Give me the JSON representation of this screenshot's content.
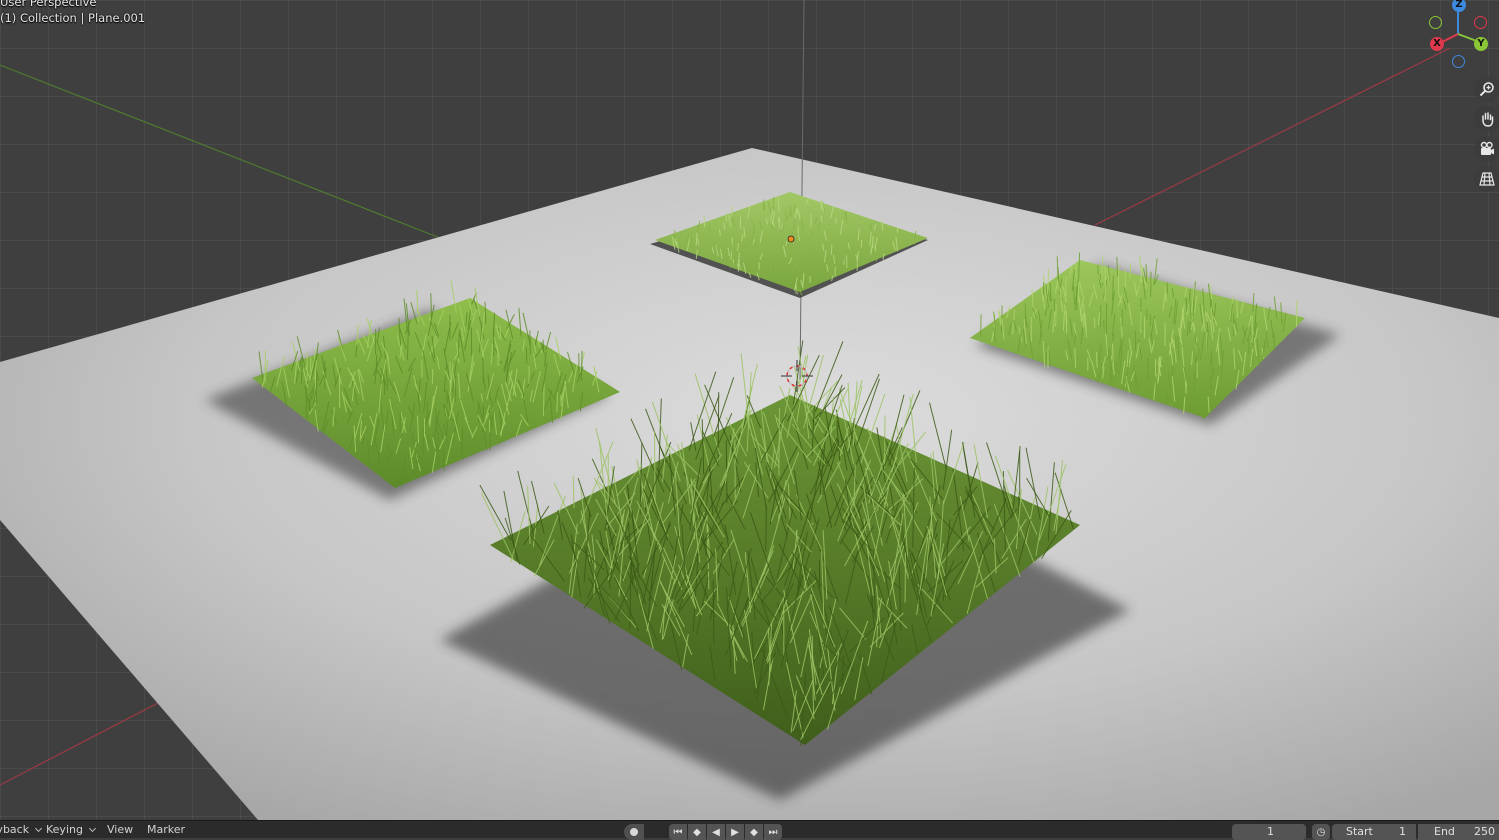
{
  "viewport": {
    "view_name": "User Perspective",
    "object_info": "(1) Collection | Plane.001"
  },
  "gizmo": {
    "z_label": "Z",
    "y_label": "Y",
    "x_label": "X",
    "x_color": "#e0384d",
    "y_color": "#8bc637",
    "z_color": "#3d8be0"
  },
  "viewport_tools": [
    "zoom-icon",
    "hand-pan-icon",
    "camera-icon",
    "grid-ortho-icon"
  ],
  "timeline": {
    "playback_label": "Playback",
    "keying_label": "Keying",
    "view_label": "View",
    "marker_label": "Marker",
    "current_frame": "1",
    "start_label": "Start",
    "start_value": "1",
    "end_label": "End",
    "end_value": "250"
  },
  "colors": {
    "grass_light": "#8fbb4f",
    "grass_mid": "#6e9a36",
    "grass_dark": "#42611d",
    "ground": "#c8c8c8",
    "grid_bg": "#3f3f3f"
  }
}
